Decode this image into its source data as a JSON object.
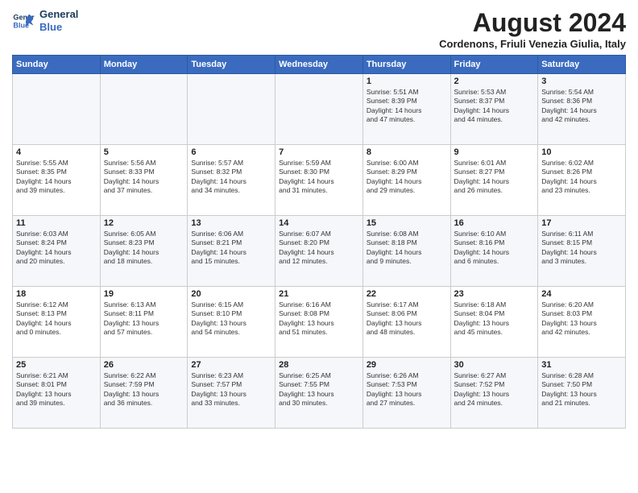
{
  "logo": {
    "line1": "General",
    "line2": "Blue"
  },
  "title": "August 2024",
  "subtitle": "Cordenons, Friuli Venezia Giulia, Italy",
  "days_of_week": [
    "Sunday",
    "Monday",
    "Tuesday",
    "Wednesday",
    "Thursday",
    "Friday",
    "Saturday"
  ],
  "weeks": [
    [
      {
        "day": "",
        "info": ""
      },
      {
        "day": "",
        "info": ""
      },
      {
        "day": "",
        "info": ""
      },
      {
        "day": "",
        "info": ""
      },
      {
        "day": "1",
        "info": "Sunrise: 5:51 AM\nSunset: 8:39 PM\nDaylight: 14 hours\nand 47 minutes."
      },
      {
        "day": "2",
        "info": "Sunrise: 5:53 AM\nSunset: 8:37 PM\nDaylight: 14 hours\nand 44 minutes."
      },
      {
        "day": "3",
        "info": "Sunrise: 5:54 AM\nSunset: 8:36 PM\nDaylight: 14 hours\nand 42 minutes."
      }
    ],
    [
      {
        "day": "4",
        "info": "Sunrise: 5:55 AM\nSunset: 8:35 PM\nDaylight: 14 hours\nand 39 minutes."
      },
      {
        "day": "5",
        "info": "Sunrise: 5:56 AM\nSunset: 8:33 PM\nDaylight: 14 hours\nand 37 minutes."
      },
      {
        "day": "6",
        "info": "Sunrise: 5:57 AM\nSunset: 8:32 PM\nDaylight: 14 hours\nand 34 minutes."
      },
      {
        "day": "7",
        "info": "Sunrise: 5:59 AM\nSunset: 8:30 PM\nDaylight: 14 hours\nand 31 minutes."
      },
      {
        "day": "8",
        "info": "Sunrise: 6:00 AM\nSunset: 8:29 PM\nDaylight: 14 hours\nand 29 minutes."
      },
      {
        "day": "9",
        "info": "Sunrise: 6:01 AM\nSunset: 8:27 PM\nDaylight: 14 hours\nand 26 minutes."
      },
      {
        "day": "10",
        "info": "Sunrise: 6:02 AM\nSunset: 8:26 PM\nDaylight: 14 hours\nand 23 minutes."
      }
    ],
    [
      {
        "day": "11",
        "info": "Sunrise: 6:03 AM\nSunset: 8:24 PM\nDaylight: 14 hours\nand 20 minutes."
      },
      {
        "day": "12",
        "info": "Sunrise: 6:05 AM\nSunset: 8:23 PM\nDaylight: 14 hours\nand 18 minutes."
      },
      {
        "day": "13",
        "info": "Sunrise: 6:06 AM\nSunset: 8:21 PM\nDaylight: 14 hours\nand 15 minutes."
      },
      {
        "day": "14",
        "info": "Sunrise: 6:07 AM\nSunset: 8:20 PM\nDaylight: 14 hours\nand 12 minutes."
      },
      {
        "day": "15",
        "info": "Sunrise: 6:08 AM\nSunset: 8:18 PM\nDaylight: 14 hours\nand 9 minutes."
      },
      {
        "day": "16",
        "info": "Sunrise: 6:10 AM\nSunset: 8:16 PM\nDaylight: 14 hours\nand 6 minutes."
      },
      {
        "day": "17",
        "info": "Sunrise: 6:11 AM\nSunset: 8:15 PM\nDaylight: 14 hours\nand 3 minutes."
      }
    ],
    [
      {
        "day": "18",
        "info": "Sunrise: 6:12 AM\nSunset: 8:13 PM\nDaylight: 14 hours\nand 0 minutes."
      },
      {
        "day": "19",
        "info": "Sunrise: 6:13 AM\nSunset: 8:11 PM\nDaylight: 13 hours\nand 57 minutes."
      },
      {
        "day": "20",
        "info": "Sunrise: 6:15 AM\nSunset: 8:10 PM\nDaylight: 13 hours\nand 54 minutes."
      },
      {
        "day": "21",
        "info": "Sunrise: 6:16 AM\nSunset: 8:08 PM\nDaylight: 13 hours\nand 51 minutes."
      },
      {
        "day": "22",
        "info": "Sunrise: 6:17 AM\nSunset: 8:06 PM\nDaylight: 13 hours\nand 48 minutes."
      },
      {
        "day": "23",
        "info": "Sunrise: 6:18 AM\nSunset: 8:04 PM\nDaylight: 13 hours\nand 45 minutes."
      },
      {
        "day": "24",
        "info": "Sunrise: 6:20 AM\nSunset: 8:03 PM\nDaylight: 13 hours\nand 42 minutes."
      }
    ],
    [
      {
        "day": "25",
        "info": "Sunrise: 6:21 AM\nSunset: 8:01 PM\nDaylight: 13 hours\nand 39 minutes."
      },
      {
        "day": "26",
        "info": "Sunrise: 6:22 AM\nSunset: 7:59 PM\nDaylight: 13 hours\nand 36 minutes."
      },
      {
        "day": "27",
        "info": "Sunrise: 6:23 AM\nSunset: 7:57 PM\nDaylight: 13 hours\nand 33 minutes."
      },
      {
        "day": "28",
        "info": "Sunrise: 6:25 AM\nSunset: 7:55 PM\nDaylight: 13 hours\nand 30 minutes."
      },
      {
        "day": "29",
        "info": "Sunrise: 6:26 AM\nSunset: 7:53 PM\nDaylight: 13 hours\nand 27 minutes."
      },
      {
        "day": "30",
        "info": "Sunrise: 6:27 AM\nSunset: 7:52 PM\nDaylight: 13 hours\nand 24 minutes."
      },
      {
        "day": "31",
        "info": "Sunrise: 6:28 AM\nSunset: 7:50 PM\nDaylight: 13 hours\nand 21 minutes."
      }
    ]
  ]
}
